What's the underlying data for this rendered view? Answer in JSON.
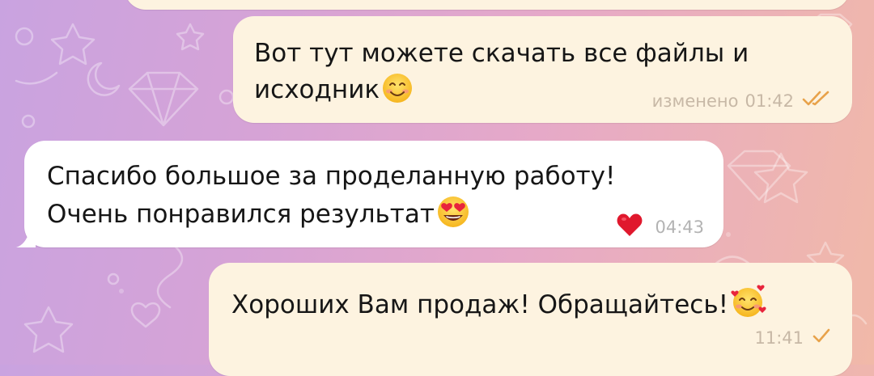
{
  "messages": [
    {
      "id": "msg-prev",
      "direction": "outgoing",
      "text": "",
      "partially_visible": true
    },
    {
      "id": "msg-files",
      "direction": "outgoing",
      "line1": "Вот тут можете скачать все файлы и",
      "line2": "исходник",
      "emoji": "smiling-face-with-smiling-eyes",
      "edited_label": "изменено",
      "time": "01:42",
      "status": "read",
      "status_icon": "double-check-icon"
    },
    {
      "id": "msg-thanks",
      "direction": "incoming",
      "line1": "Спасибо большое за проделанную работу!",
      "line2": "Очень понравился результат",
      "emoji": "smiling-face-with-heart-eyes",
      "reaction": "red-heart",
      "time": "04:43"
    },
    {
      "id": "msg-sales",
      "direction": "outgoing",
      "line1": "Хороших Вам продаж! Обращайтесь!",
      "emoji": "smiling-face-with-hearts",
      "time": "11:41",
      "status": "sent",
      "status_icon": "single-check-icon"
    }
  ],
  "colors": {
    "outgoing_bubble": "#fdf3e0",
    "incoming_bubble": "#ffffff",
    "check_color": "#e8a24a",
    "heart_color": "#e0182d",
    "background_start": "#c9a3e0",
    "background_end": "#f1b9a8"
  }
}
